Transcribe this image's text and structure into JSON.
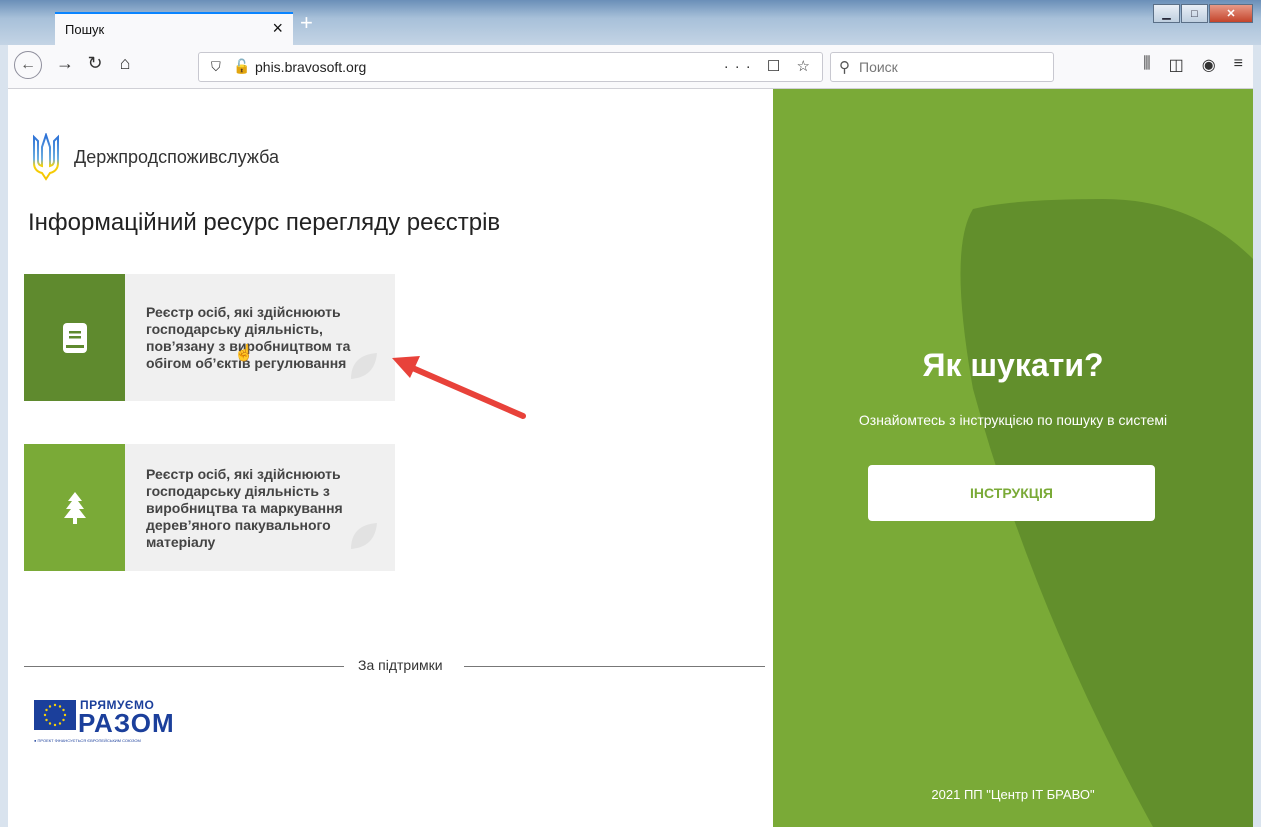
{
  "browser": {
    "tab_title": "Пошук",
    "tab_close": "×",
    "new_tab": "+",
    "url": "phis.bravosoft.org",
    "search_placeholder": "Поиск",
    "url_actions": "··· ☐ ☆"
  },
  "page": {
    "org_name": "Держпродспоживслужба",
    "title": "Інформаційний ресурс перегляду реєстрів",
    "cards": [
      {
        "text": "Реєстр осіб, які здійснюють господарську діяльність, пов’язану з виробництвом та обігом об’єктів регулювання",
        "icon": "book-icon",
        "color": "#5f8a2e"
      },
      {
        "text": "Реєстр осіб, які здійснюють господарську діяльність з виробництва та маркування дерев’яного пакувального матеріалу",
        "icon": "tree-icon",
        "color": "#7aaa37"
      }
    ],
    "support_label": "За підтримки",
    "sponsor": {
      "line1": "ПРЯМУЄМО",
      "line2": "РАЗОМ",
      "footnote": "● ПРОЕКТ ФІНАНСУЄТЬСЯ ЄВРОПЕЙСЬКИМ СОЮЗОМ"
    }
  },
  "help_panel": {
    "title": "Як шукати?",
    "description": "Ознайомтесь з інструкцією по пошуку в системі",
    "button_label": "ІНСТРУКЦІЯ",
    "copyright": "2021 ПП \"Центр IT БРАВО\""
  },
  "colors": {
    "panel_green": "#7aaa37",
    "dark_green": "#5f8a2e",
    "arrow_red": "#e8423a"
  }
}
